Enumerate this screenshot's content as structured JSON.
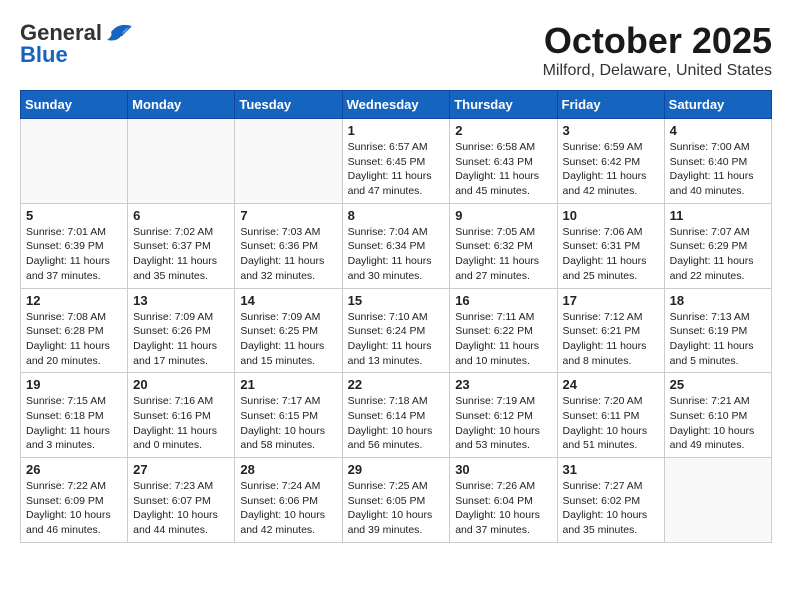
{
  "header": {
    "logo_general": "General",
    "logo_blue": "Blue",
    "title": "October 2025",
    "subtitle": "Milford, Delaware, United States"
  },
  "days_of_week": [
    "Sunday",
    "Monday",
    "Tuesday",
    "Wednesday",
    "Thursday",
    "Friday",
    "Saturday"
  ],
  "weeks": [
    [
      {
        "day": "",
        "info": ""
      },
      {
        "day": "",
        "info": ""
      },
      {
        "day": "",
        "info": ""
      },
      {
        "day": "1",
        "info": "Sunrise: 6:57 AM\nSunset: 6:45 PM\nDaylight: 11 hours and 47 minutes."
      },
      {
        "day": "2",
        "info": "Sunrise: 6:58 AM\nSunset: 6:43 PM\nDaylight: 11 hours and 45 minutes."
      },
      {
        "day": "3",
        "info": "Sunrise: 6:59 AM\nSunset: 6:42 PM\nDaylight: 11 hours and 42 minutes."
      },
      {
        "day": "4",
        "info": "Sunrise: 7:00 AM\nSunset: 6:40 PM\nDaylight: 11 hours and 40 minutes."
      }
    ],
    [
      {
        "day": "5",
        "info": "Sunrise: 7:01 AM\nSunset: 6:39 PM\nDaylight: 11 hours and 37 minutes."
      },
      {
        "day": "6",
        "info": "Sunrise: 7:02 AM\nSunset: 6:37 PM\nDaylight: 11 hours and 35 minutes."
      },
      {
        "day": "7",
        "info": "Sunrise: 7:03 AM\nSunset: 6:36 PM\nDaylight: 11 hours and 32 minutes."
      },
      {
        "day": "8",
        "info": "Sunrise: 7:04 AM\nSunset: 6:34 PM\nDaylight: 11 hours and 30 minutes."
      },
      {
        "day": "9",
        "info": "Sunrise: 7:05 AM\nSunset: 6:32 PM\nDaylight: 11 hours and 27 minutes."
      },
      {
        "day": "10",
        "info": "Sunrise: 7:06 AM\nSunset: 6:31 PM\nDaylight: 11 hours and 25 minutes."
      },
      {
        "day": "11",
        "info": "Sunrise: 7:07 AM\nSunset: 6:29 PM\nDaylight: 11 hours and 22 minutes."
      }
    ],
    [
      {
        "day": "12",
        "info": "Sunrise: 7:08 AM\nSunset: 6:28 PM\nDaylight: 11 hours and 20 minutes."
      },
      {
        "day": "13",
        "info": "Sunrise: 7:09 AM\nSunset: 6:26 PM\nDaylight: 11 hours and 17 minutes."
      },
      {
        "day": "14",
        "info": "Sunrise: 7:09 AM\nSunset: 6:25 PM\nDaylight: 11 hours and 15 minutes."
      },
      {
        "day": "15",
        "info": "Sunrise: 7:10 AM\nSunset: 6:24 PM\nDaylight: 11 hours and 13 minutes."
      },
      {
        "day": "16",
        "info": "Sunrise: 7:11 AM\nSunset: 6:22 PM\nDaylight: 11 hours and 10 minutes."
      },
      {
        "day": "17",
        "info": "Sunrise: 7:12 AM\nSunset: 6:21 PM\nDaylight: 11 hours and 8 minutes."
      },
      {
        "day": "18",
        "info": "Sunrise: 7:13 AM\nSunset: 6:19 PM\nDaylight: 11 hours and 5 minutes."
      }
    ],
    [
      {
        "day": "19",
        "info": "Sunrise: 7:15 AM\nSunset: 6:18 PM\nDaylight: 11 hours and 3 minutes."
      },
      {
        "day": "20",
        "info": "Sunrise: 7:16 AM\nSunset: 6:16 PM\nDaylight: 11 hours and 0 minutes."
      },
      {
        "day": "21",
        "info": "Sunrise: 7:17 AM\nSunset: 6:15 PM\nDaylight: 10 hours and 58 minutes."
      },
      {
        "day": "22",
        "info": "Sunrise: 7:18 AM\nSunset: 6:14 PM\nDaylight: 10 hours and 56 minutes."
      },
      {
        "day": "23",
        "info": "Sunrise: 7:19 AM\nSunset: 6:12 PM\nDaylight: 10 hours and 53 minutes."
      },
      {
        "day": "24",
        "info": "Sunrise: 7:20 AM\nSunset: 6:11 PM\nDaylight: 10 hours and 51 minutes."
      },
      {
        "day": "25",
        "info": "Sunrise: 7:21 AM\nSunset: 6:10 PM\nDaylight: 10 hours and 49 minutes."
      }
    ],
    [
      {
        "day": "26",
        "info": "Sunrise: 7:22 AM\nSunset: 6:09 PM\nDaylight: 10 hours and 46 minutes."
      },
      {
        "day": "27",
        "info": "Sunrise: 7:23 AM\nSunset: 6:07 PM\nDaylight: 10 hours and 44 minutes."
      },
      {
        "day": "28",
        "info": "Sunrise: 7:24 AM\nSunset: 6:06 PM\nDaylight: 10 hours and 42 minutes."
      },
      {
        "day": "29",
        "info": "Sunrise: 7:25 AM\nSunset: 6:05 PM\nDaylight: 10 hours and 39 minutes."
      },
      {
        "day": "30",
        "info": "Sunrise: 7:26 AM\nSunset: 6:04 PM\nDaylight: 10 hours and 37 minutes."
      },
      {
        "day": "31",
        "info": "Sunrise: 7:27 AM\nSunset: 6:02 PM\nDaylight: 10 hours and 35 minutes."
      },
      {
        "day": "",
        "info": ""
      }
    ]
  ]
}
